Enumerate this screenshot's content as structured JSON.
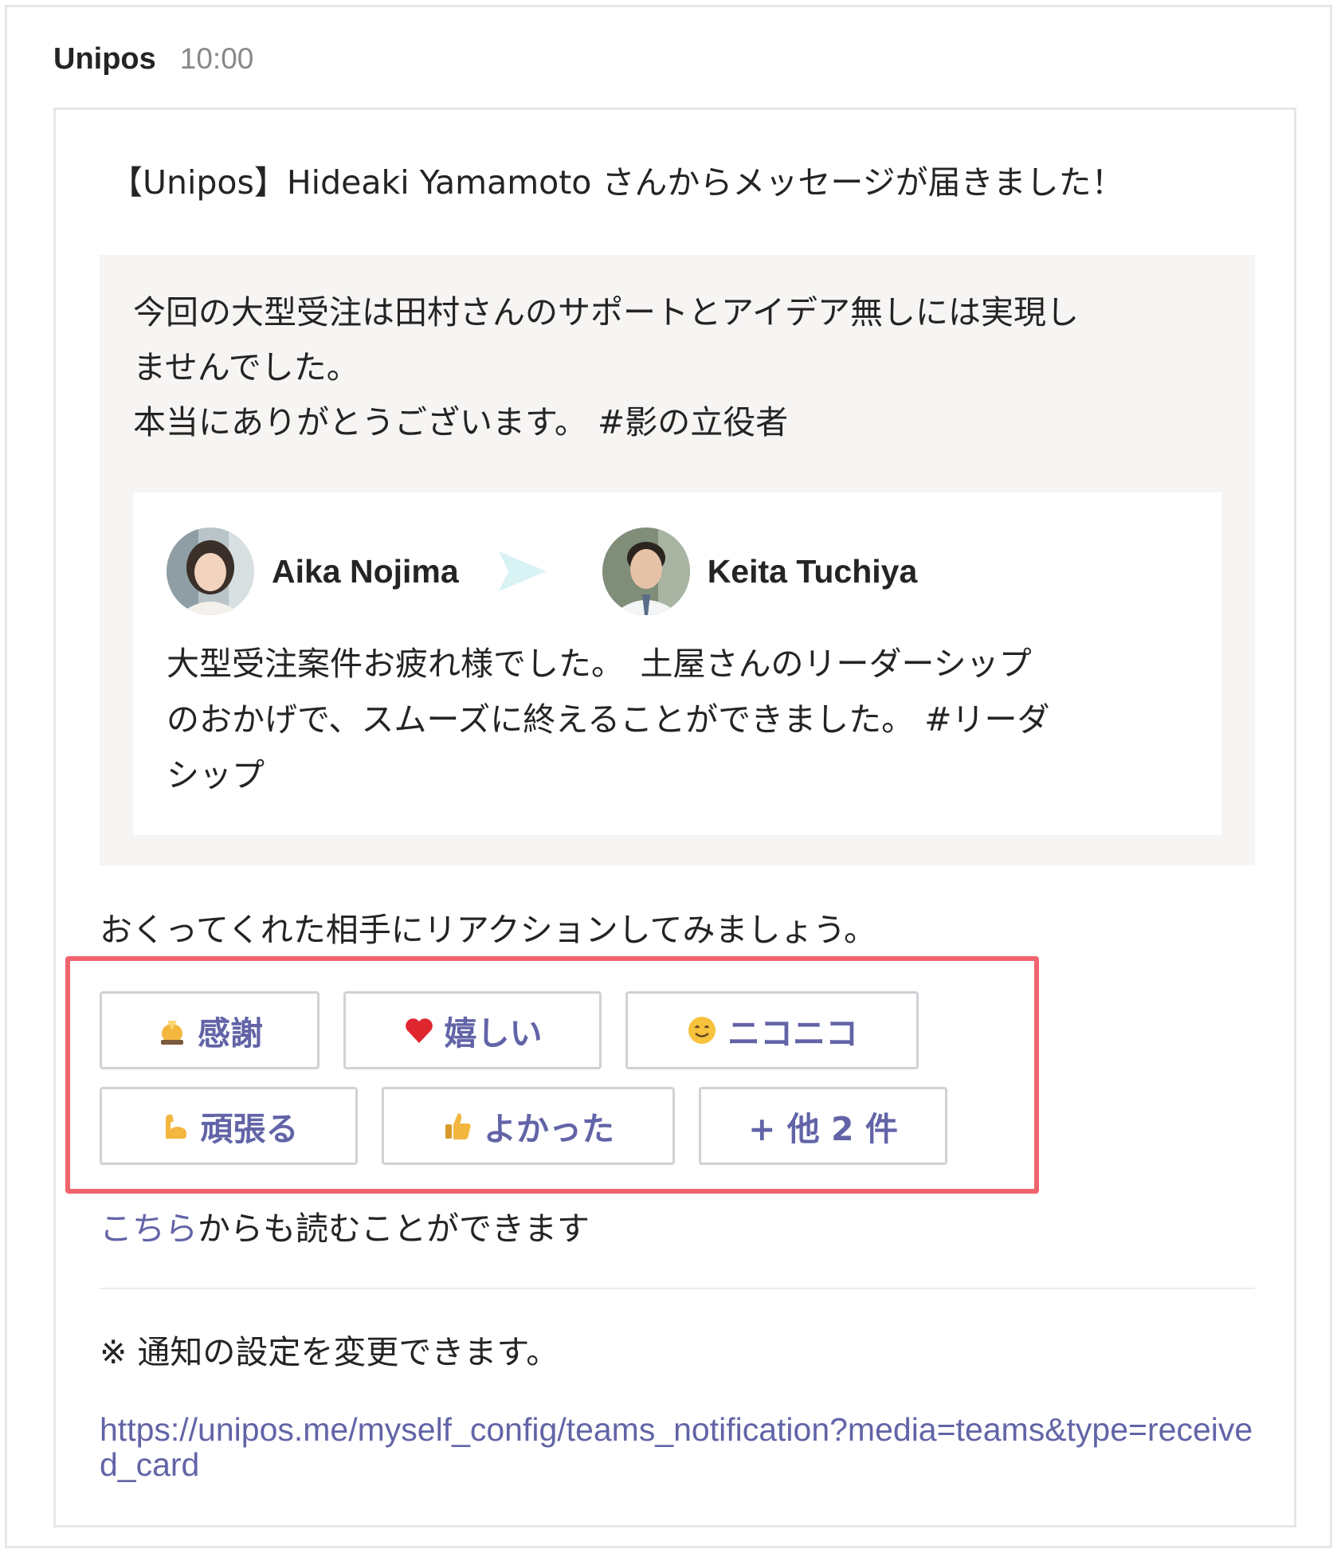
{
  "header": {
    "sender": "Unipos",
    "time": "10:00"
  },
  "card": {
    "title": "【Unipos】Hideaki Yamamoto さんからメッセージが届きました！",
    "message_lines": [
      "今回の大型受注は田村さんのサポートとアイデア無しには実現し",
      "ませんでした。",
      "本当にありがとうございます。 #影の立役者"
    ],
    "post": {
      "from_name": "Aika Nojima",
      "to_name": "Keita Tuchiya",
      "text_lines": [
        "大型受注案件お疲れ様でした。　土屋さんのリーダーシップ",
        "のおかげで、スムーズに終えることができました。 #リーダ",
        "シップ"
      ]
    },
    "prompt": "おくってくれた相手にリアクションしてみましょう。",
    "reactions": [
      {
        "label": "感謝",
        "icon": "praying-emoji-icon"
      },
      {
        "label": "嬉しい",
        "icon": "heart-emoji-icon"
      },
      {
        "label": "ニコニコ",
        "icon": "smile-emoji-icon"
      },
      {
        "label": "頑張る",
        "icon": "flexed-biceps-emoji-icon"
      },
      {
        "label": "よかった",
        "icon": "thumbs-up-emoji-icon"
      },
      {
        "label": "+ 他 2 件",
        "icon": ""
      }
    ],
    "read_more": {
      "link_text": "こちら",
      "rest_text": "からも読むことができます"
    },
    "note": "※ 通知の設定を変更できます。",
    "settings_url": "https://unipos.me/myself_config/teams_notification?media=teams&type=received_card"
  },
  "colors": {
    "accent": "#6264a7",
    "highlight": "#f0646e",
    "message_bg": "#f6f5f4",
    "border": "#e5e7e8",
    "arrow": "#d9f3f5"
  }
}
